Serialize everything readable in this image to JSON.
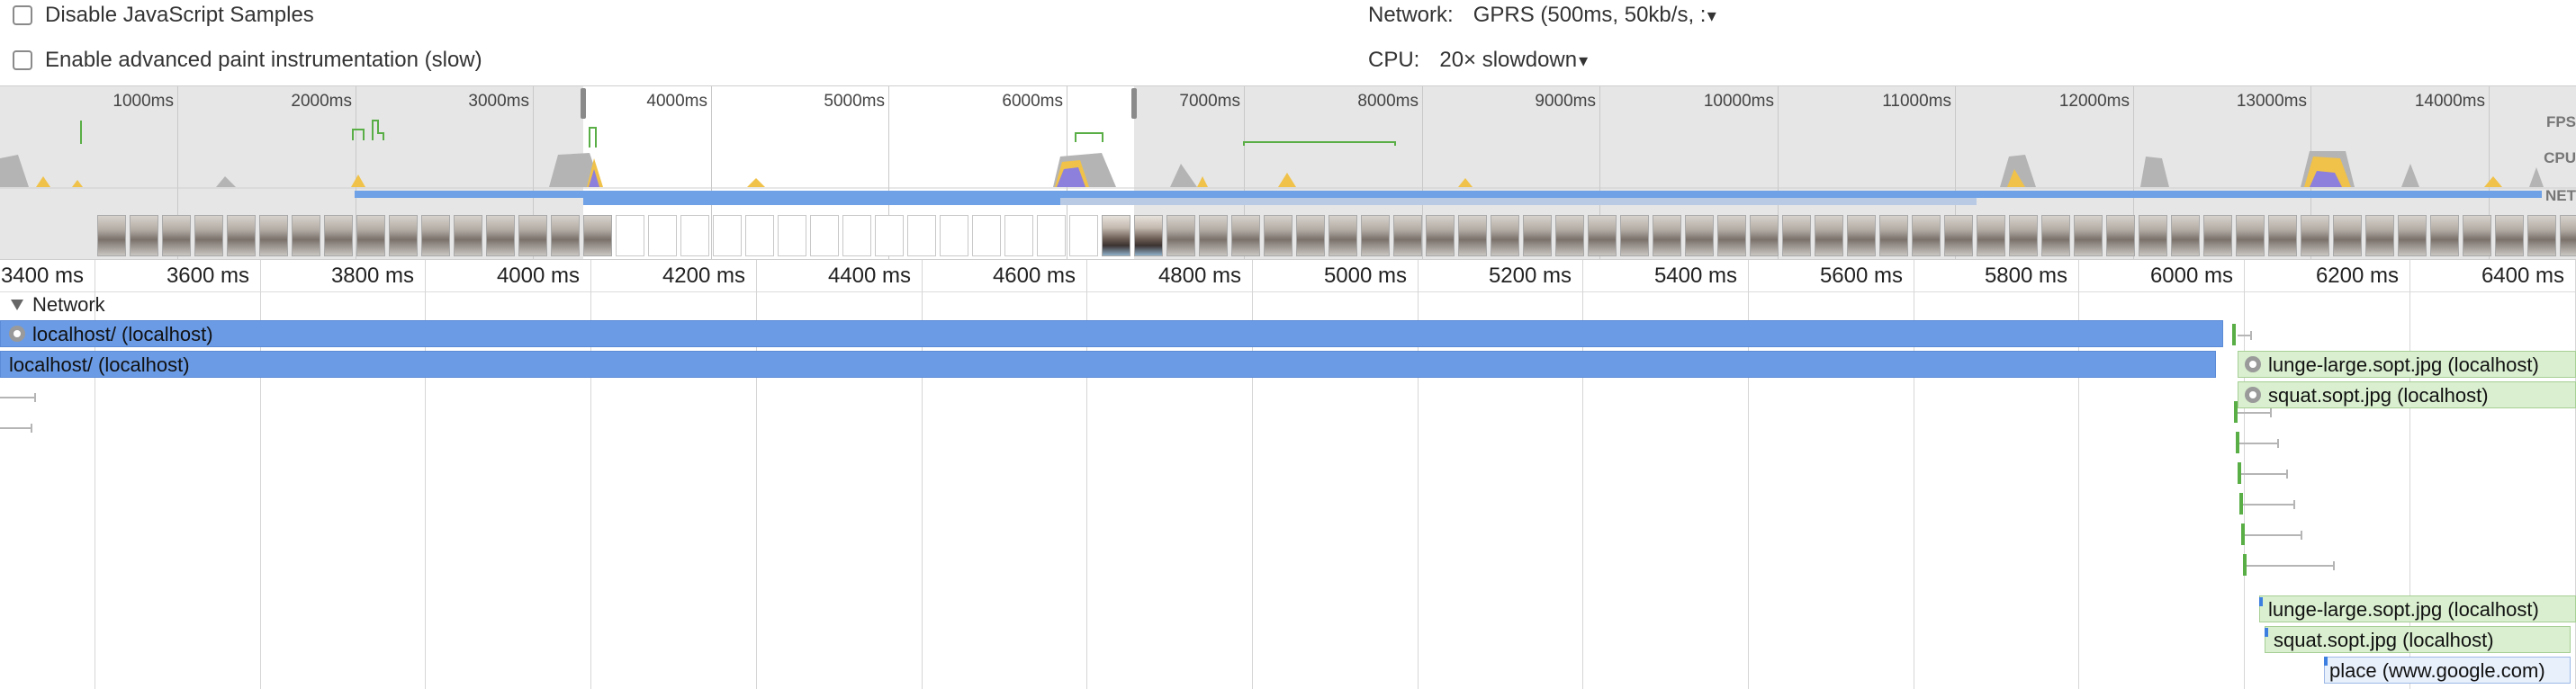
{
  "settings": {
    "disable_js_samples": "Disable JavaScript Samples",
    "advanced_paint": "Enable advanced paint instrumentation (slow)",
    "network_caption": "Network:",
    "network_value": "GPRS (500ms, 50kb/s, :",
    "cpu_caption": "CPU:",
    "cpu_value": "20× slowdown"
  },
  "overview": {
    "ticks": [
      "1000ms",
      "2000ms",
      "3000ms",
      "4000ms",
      "5000ms",
      "6000ms",
      "7000ms",
      "8000ms",
      "9000ms",
      "10000ms",
      "11000ms",
      "12000ms",
      "13000ms",
      "14000ms"
    ],
    "track_labels": {
      "fps": "FPS",
      "cpu": "CPU",
      "net": "NET"
    }
  },
  "timeline": {
    "ruler": [
      "3400 ms",
      "3600 ms",
      "3800 ms",
      "4000 ms",
      "4200 ms",
      "4400 ms",
      "4600 ms",
      "4800 ms",
      "5000 ms",
      "5200 ms",
      "5400 ms",
      "5600 ms",
      "5800 ms",
      "6000 ms",
      "6200 ms",
      "6400 ms"
    ],
    "network_section": "Network",
    "requests": [
      {
        "label": "localhost/ (localhost)"
      },
      {
        "label": "localhost/ (localhost)"
      },
      {
        "label": "lunge-large.sopt.jpg (localhost)"
      },
      {
        "label": "squat.sopt.jpg (localhost)"
      },
      {
        "label": "lunge-large.sopt.jpg (localhost)"
      },
      {
        "label": "squat.sopt.jpg (localhost)"
      },
      {
        "label": "place (www.google.com)"
      }
    ]
  },
  "colors": {
    "request_blue": "#6b9be4",
    "image_green": "#d9efcf",
    "cpu_yellow": "#f0c24a",
    "cpu_purple": "#8d7fdc",
    "fps_green": "#5aae46"
  }
}
